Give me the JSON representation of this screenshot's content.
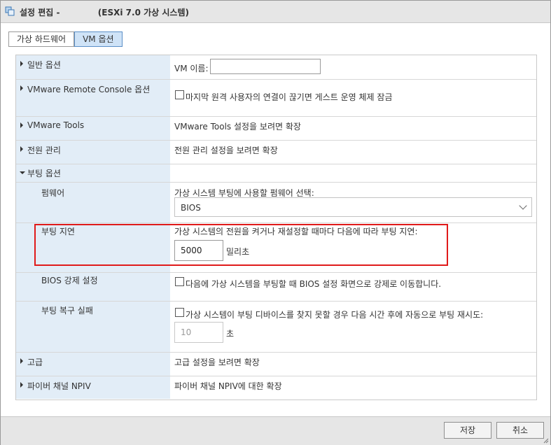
{
  "titlebar": {
    "title": "설정 편집 -             (ESXi 7.0 가상 시스템)",
    "icon": "vm-settings-icon"
  },
  "tabs": [
    {
      "label": "가상 하드웨어",
      "active": false
    },
    {
      "label": "VM 옵션",
      "active": true
    }
  ],
  "rows": {
    "general": {
      "label": "일반 옵션",
      "vm_name_label": "VM 이름:",
      "vm_name_value": ""
    },
    "vmrc": {
      "label": "VMware Remote Console 옵션",
      "lock_text": "마지막 원격 사용자의 연결이 끊기면 게스트 운영 체제 잠금",
      "lock_checked": false
    },
    "tools": {
      "label": "VMware Tools",
      "value": "VMware Tools 설정을 보려면 확장"
    },
    "power": {
      "label": "전원 관리",
      "value": "전원 관리 설정을 보려면 확장"
    },
    "boot": {
      "label": "부팅 옵션"
    },
    "firmware": {
      "label": "펌웨어",
      "desc": "가상 시스템 부팅에 사용할 펌웨어 선택:",
      "selected": "BIOS"
    },
    "boot_delay": {
      "label": "부팅 지연",
      "desc": "가상 시스템의 전원을 켜거나 재설정할 때마다 다음에 따라 부팅 지연:",
      "value": "5000",
      "unit": "밀리초"
    },
    "bios_setup": {
      "label": "BIOS 강제 설정",
      "text": "다음에 가상 시스템을 부팅할 때 BIOS 설정 화면으로 강제로 이동합니다.",
      "checked": false
    },
    "boot_retry": {
      "label": "부팅 복구 실패",
      "text": "가상 시스템이 부팅 디바이스를 찾지 못할 경우 다음 시간 후에 자동으로 부팅 재시도:",
      "checked": false,
      "value": "10",
      "unit": "초"
    },
    "advanced": {
      "label": "고급",
      "value": "고급 설정을 보려면 확장"
    },
    "npiv": {
      "label": "파이버 채널 NPIV",
      "value": "파이버 채널 NPIV에 대한 확장"
    }
  },
  "footer": {
    "save_label": "저장",
    "cancel_label": "취소"
  },
  "colors": {
    "highlight": "#e01a1a",
    "label_bg": "#e2edf7",
    "active_tab": "#cfe3f7"
  }
}
